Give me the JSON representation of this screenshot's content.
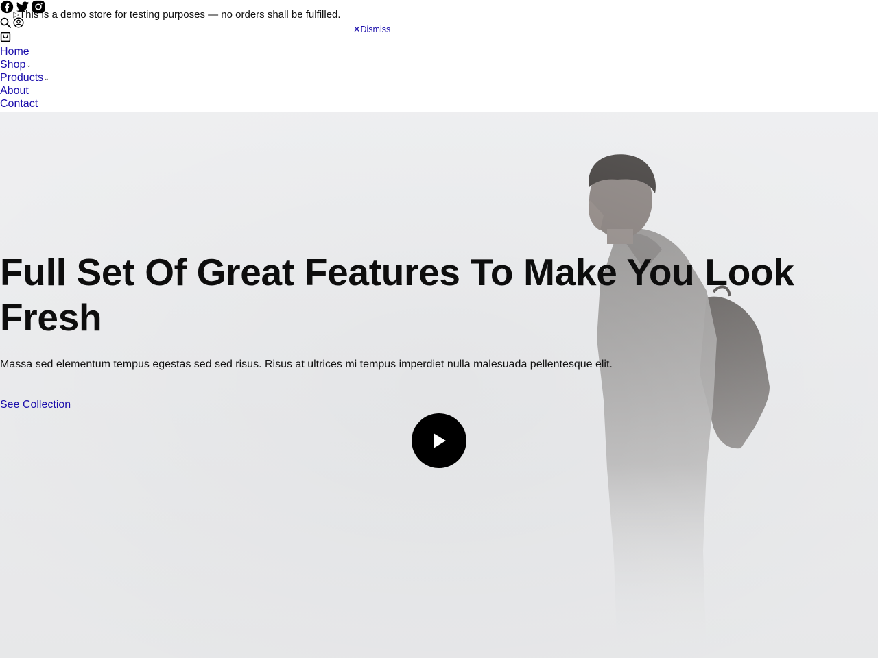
{
  "header": {
    "social": [
      {
        "icon": "facebook-icon"
      },
      {
        "icon": "twitter-icon"
      },
      {
        "icon": "instagram-icon"
      }
    ],
    "notice": {
      "text": "This is a demo store for testing purposes — no orders shall be fulfilled.",
      "dismiss_label": "Dismiss",
      "dismiss_icon": "close-icon"
    },
    "tools": [
      {
        "icon": "search-icon"
      },
      {
        "icon": "account-icon"
      },
      {
        "icon": "cart-icon"
      }
    ],
    "nav": [
      {
        "label": "Home",
        "has_dropdown": false
      },
      {
        "label": "Shop",
        "has_dropdown": true
      },
      {
        "label": "Products",
        "has_dropdown": true
      },
      {
        "label": "About",
        "has_dropdown": false
      },
      {
        "label": "Contact",
        "has_dropdown": false
      }
    ]
  },
  "hero": {
    "title": "Full Set Of Great Features To Make You Look Fresh",
    "text": "Massa sed elementum tempus egestas sed sed risus. Risus at ultrices mi tempus imperdiet nulla malesuada pellentesque elit.",
    "cta_label": "See Collection",
    "play_icon": "play-icon"
  },
  "colors": {
    "link": "#1a0dab",
    "hero_bg": "#e4e5e7",
    "title": "#0d0d0d",
    "play_button": "#000000"
  }
}
